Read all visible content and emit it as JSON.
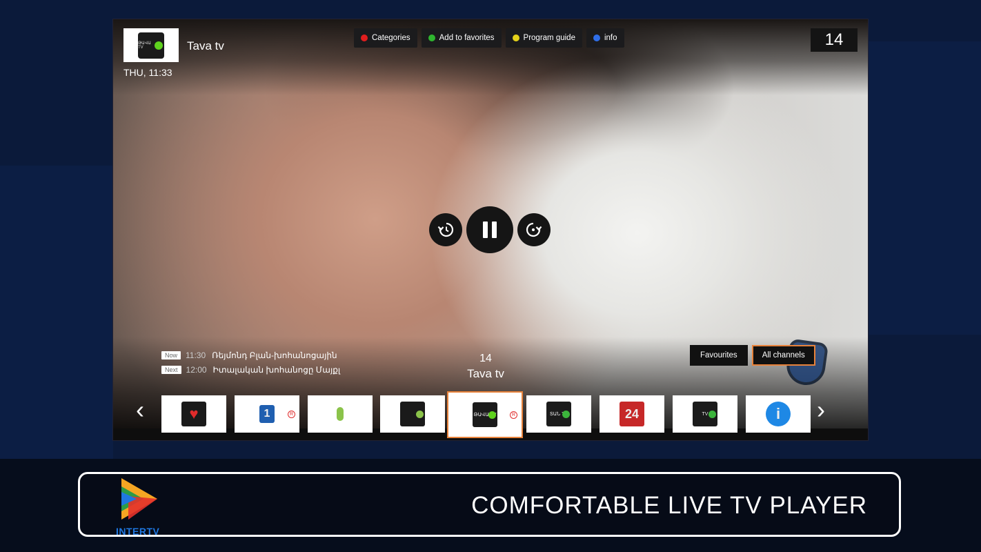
{
  "header": {
    "channel_name": "Tava tv",
    "datetime": "THU, 11:33",
    "channel_number": "14",
    "logo_text": "ԹԱՎԱ TV"
  },
  "top_buttons": [
    {
      "label": "Categories",
      "color": "#e01e1e"
    },
    {
      "label": "Add to favorites",
      "color": "#2fb52f"
    },
    {
      "label": "Program guide",
      "color": "#e5d21a"
    },
    {
      "label": "info",
      "color": "#2f6ee8"
    }
  ],
  "epg": {
    "now_tag": "Now",
    "now_time": "11:30",
    "now_title": "Ռեյմոնդ Բլան-խոհանոցային",
    "next_tag": "Next",
    "next_time": "12:00",
    "next_title": "Իտալական խոհանոցը Մայքլ"
  },
  "current": {
    "number": "14",
    "name": "Tava tv"
  },
  "list_tabs": {
    "favourites": "Favourites",
    "all_channels": "All channels"
  },
  "carousel": [
    {
      "name": "heart-channel-logo",
      "bg": "#1a1a1a",
      "text": "",
      "accent": "#e02b2b",
      "registered": false
    },
    {
      "name": "first-channel-logo",
      "bg": "#1f5fb0",
      "text": "1",
      "accent": "#1f5fb0",
      "registered": true
    },
    {
      "name": "arm-channel-logo",
      "bg": "#ffffff",
      "text": "",
      "accent": "#8bc34a",
      "registered": false
    },
    {
      "name": "music-channel-logo",
      "bg": "#1a1a1a",
      "text": "",
      "accent": "#8bc34a",
      "registered": false
    },
    {
      "name": "tava-tv-logo",
      "bg": "#1b1b1b",
      "text": "ԹԱՎԱ TV",
      "accent": "#5fd21e",
      "registered": true
    },
    {
      "name": "star-tv-logo",
      "bg": "#1b1b1b",
      "text": "ՏԱՆ TV",
      "accent": "#3cb43c",
      "registered": false
    },
    {
      "name": "armnews-24-logo",
      "bg": "#c62828",
      "text": "24",
      "accent": "#ffffff",
      "registered": false
    },
    {
      "name": "kids-tv-logo",
      "bg": "#1b1b1b",
      "text": "TV",
      "accent": "#3cb43c",
      "registered": false
    },
    {
      "name": "info-channel-logo",
      "bg": "#1e88e5",
      "text": "i",
      "accent": "#ffffff",
      "registered": false
    }
  ],
  "banner": {
    "brand": "INTERTV",
    "title": "COMFORTABLE LIVE TV PLAYER"
  },
  "icons": {
    "prev": "chevron-left-icon",
    "next": "chevron-right-icon",
    "rewind": "replay-icon",
    "pause": "pause-icon",
    "forward": "forward-icon"
  },
  "colors": {
    "selection": "#e8823a"
  }
}
